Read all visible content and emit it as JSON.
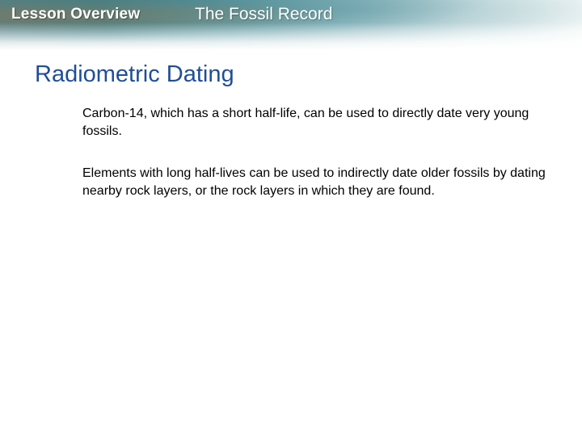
{
  "header": {
    "section_label": "Lesson Overview",
    "course_title": "The Fossil Record"
  },
  "slide": {
    "title": "Radiometric Dating",
    "paragraphs": [
      "Carbon-14, which has a short half-life, can be used to directly date very young fossils.",
      "Elements with long half-lives can be used to indirectly date older fossils by dating nearby rock layers, or the rock layers in which they are found."
    ]
  }
}
